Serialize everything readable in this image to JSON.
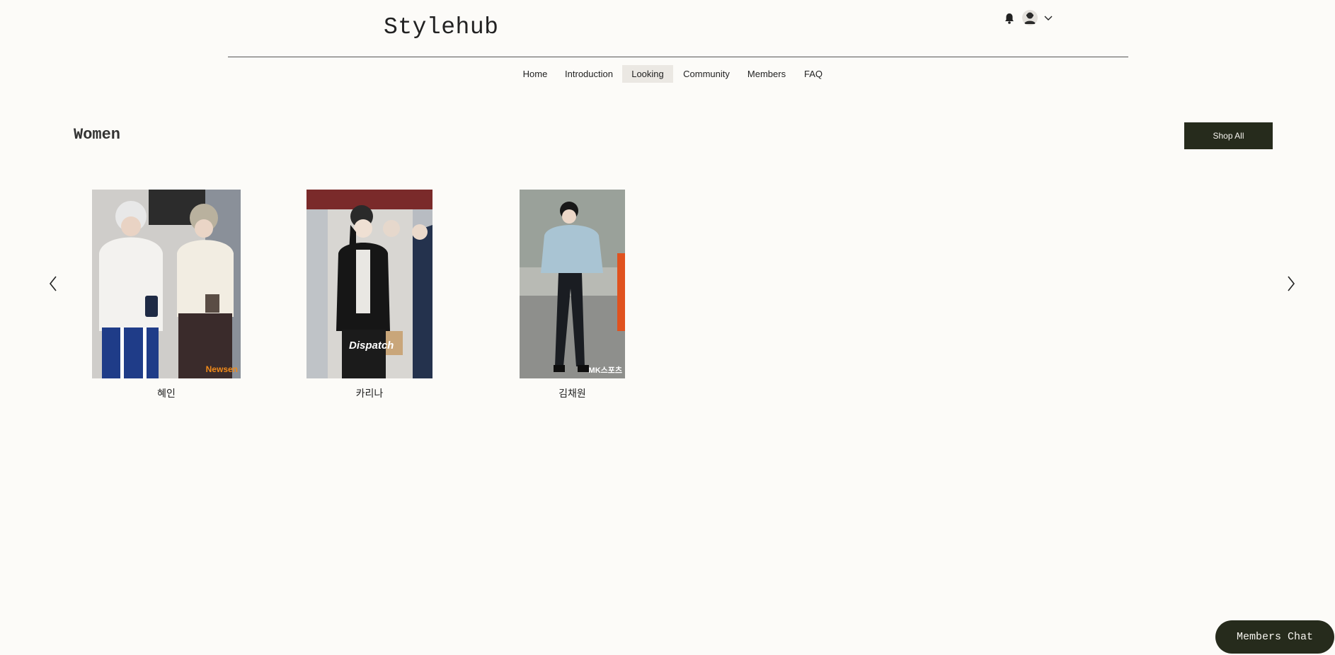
{
  "header": {
    "brand": "Stylehub"
  },
  "nav": {
    "items": [
      {
        "label": "Home"
      },
      {
        "label": "Introduction"
      },
      {
        "label": "Looking",
        "active": true
      },
      {
        "label": "Community"
      },
      {
        "label": "Members"
      },
      {
        "label": "FAQ"
      }
    ]
  },
  "section": {
    "title": "Women",
    "shop_all_label": "Shop All"
  },
  "gallery": {
    "items": [
      {
        "name": "혜인",
        "photo_watermark": "Newsen"
      },
      {
        "name": "카리나",
        "photo_watermark": "Dispatch"
      },
      {
        "name": "김채원",
        "photo_watermark": "MK스포츠"
      }
    ]
  },
  "chat": {
    "label": "Members Chat"
  },
  "colors": {
    "background": "#fcfbf8",
    "accent_dark": "#262b1c",
    "active_nav_bg": "#ebe8e3"
  },
  "icons": [
    "bell-icon",
    "avatar-icon",
    "chevron-down-icon",
    "chevron-left-icon",
    "chevron-right-icon"
  ]
}
